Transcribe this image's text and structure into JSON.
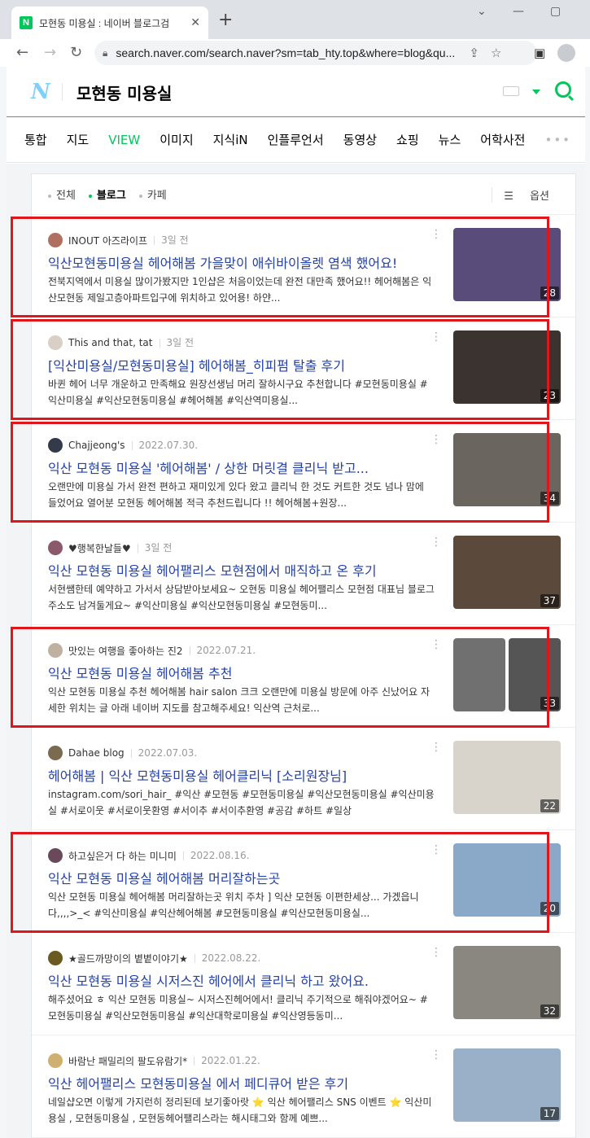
{
  "browser": {
    "tab_title": "모현동 미용실 : 네이버 블로그검",
    "favicon_letter": "N",
    "url": "search.naver.com/search.naver?sm=tab_hty.top&where=blog&qu..."
  },
  "header": {
    "query": "모현동 미용실"
  },
  "tabs": [
    {
      "label": "통합"
    },
    {
      "label": "지도"
    },
    {
      "label": "VIEW",
      "active": true
    },
    {
      "label": "이미지"
    },
    {
      "label": "지식iN"
    },
    {
      "label": "인플루언서"
    },
    {
      "label": "동영상"
    },
    {
      "label": "쇼핑"
    },
    {
      "label": "뉴스"
    },
    {
      "label": "어학사전"
    }
  ],
  "filter": {
    "all": "전체",
    "blog": "블로그",
    "cafe": "카페",
    "options": "옵션"
  },
  "results": [
    {
      "author": "INOUT 아즈라이프",
      "date": "3일 전",
      "title": "익산모현동미용실 헤어해봄 가을맞이 애쉬바이올렛 염색 했어요!",
      "desc": "전북지역에서 미용실 많이가봤지만 1인샵은 처음이었는데 완전 대만족 했어요!! 헤어해봄은 익산모현동 제일고층아파트입구에 위치하고 있어용! 하얀...",
      "count": "28",
      "thumb_color": "#5a4c7a",
      "prof_color": "#b07060",
      "highlight": true
    },
    {
      "author": "This and that, tat",
      "date": "3일 전",
      "title": "[익산미용실/모현동미용실] 헤어해봄_히피펌 탈출 후기",
      "desc": "바퀸 헤어 너무 개운하고 만족해요 원장선생님 머리 잘하시구요 추천합니다 #모현동미용실 #익산미용실 #익산모현동미용실 #헤어해봄 #익산역미용실...",
      "count": "23",
      "thumb_color": "#3a3330",
      "prof_color": "#d8d0c4",
      "highlight": true
    },
    {
      "author": "Chajjeong's",
      "date": "2022.07.30.",
      "title": "익산 모현동 미용실 '헤어해봄' / 상한 머릿결 클리닉 받고...",
      "desc": "오랜만에 미용실 가서 완전 편하고 재미있게 있다 왔고 클리닉 한 것도 커트한 것도 넘나 맘에 들었어요 열어분 모현동 헤어해봄 적극 추천드립니다 !! 헤어해봄+원장...",
      "count": "34",
      "thumb_color": "#6b6560",
      "prof_color": "#333a4a",
      "highlight": true
    },
    {
      "author": "♥행복한날들♥",
      "date": "3일 전",
      "title": "익산 모현동 미용실 헤어팰리스 모현점에서 매직하고 온 후기",
      "desc": "서현쌤한테 예약하고 가서서 상담받아보세요~ 오현동 미용실 헤어팰리스 모현점 대표님 블로그 주소도 남겨둘게요~ #익산미용실 #익산모현동미용실 #모현동미...",
      "count": "37",
      "thumb_color": "#5b4a3c",
      "prof_color": "#8a5a6a",
      "highlight": false
    },
    {
      "author": "맛있는 여행을 좋아하는 진2",
      "date": "2022.07.21.",
      "title": "익산 모현동 미용실 헤어해봄 추천",
      "desc": "익산 모현동 미용실 추천 헤어해봄 hair salon 크크 오랜만에 미용실 방문에 아주 신났어요 자세한 위치는 글 아래 네이버 지도를 참고해주세요! 익산역 근처로...",
      "count": "33",
      "thumb_color": "#707070",
      "prof_color": "#c0b0a0",
      "highlight": true,
      "two_thumbs": true
    },
    {
      "author": "Dahae blog",
      "date": "2022.07.03.",
      "title": "헤어해봄 | 익산 모현동미용실 헤어클리닉 [소리원장님]",
      "desc": "instagram.com/sori_hair_ #익산 #모현동 #모현동미용실 #익산모현동미용실 #익산미용실 #서로이웃 #서로이웃환영 #서이추 #서이추환영 #공감 #하트 #일상",
      "count": "22",
      "thumb_color": "#d8d4cc",
      "prof_color": "#7a6a50",
      "highlight": false
    },
    {
      "author": "하고싶은거 다 하는 미니미",
      "date": "2022.08.16.",
      "title": "익산 모현동 미용실 헤어해봄 머리잘하는곳",
      "desc": "익산 모현동 미용실 헤어해봄 머리잘하는곳 위치 주차 ] 익산 모현동 이편한세상... 가겠읍니다,,,,>_< #익산미용실 #익산헤어해봄 #모현동미용실 #익산모현동미용실...",
      "count": "20",
      "thumb_color": "#8aa8c8",
      "prof_color": "#6a4a5a",
      "highlight": true
    },
    {
      "author": "★골드까망이의 볕볕이야기★",
      "date": "2022.08.22.",
      "title": "익산 모현동 미용실 시저스진 헤어에서 클리닉 하고 왔어요.",
      "desc": "해주셨어요 ㅎ 익산 모현동 미용실~ 시저스진헤어에서! 클리닉 주기적으로 해줘야겠어요~ #모현동미용실 #익산모현동미용실 #익산대학로미용실 #익산영등동미...",
      "count": "32",
      "thumb_color": "#8a8680",
      "prof_color": "#6a5a20",
      "highlight": false
    },
    {
      "author": "바람난 패밀리의 팔도유람기*",
      "date": "2022.01.22.",
      "title": "익산 헤어팰리스 모현동미용실 에서 페디큐어 받은 후기",
      "desc": "네일샵오면 이렇게 가지런히 정리된데 보기좋아랏 ⭐ 익산 헤어팰리스 SNS 이벤트 ⭐ 익산미용실 , 모현동미용실 , 모현동헤어팰리스라는 해시태그와 함께 예쁘...",
      "count": "17",
      "thumb_color": "#9ab0c8",
      "prof_color": "#d0b070",
      "highlight": false
    }
  ]
}
